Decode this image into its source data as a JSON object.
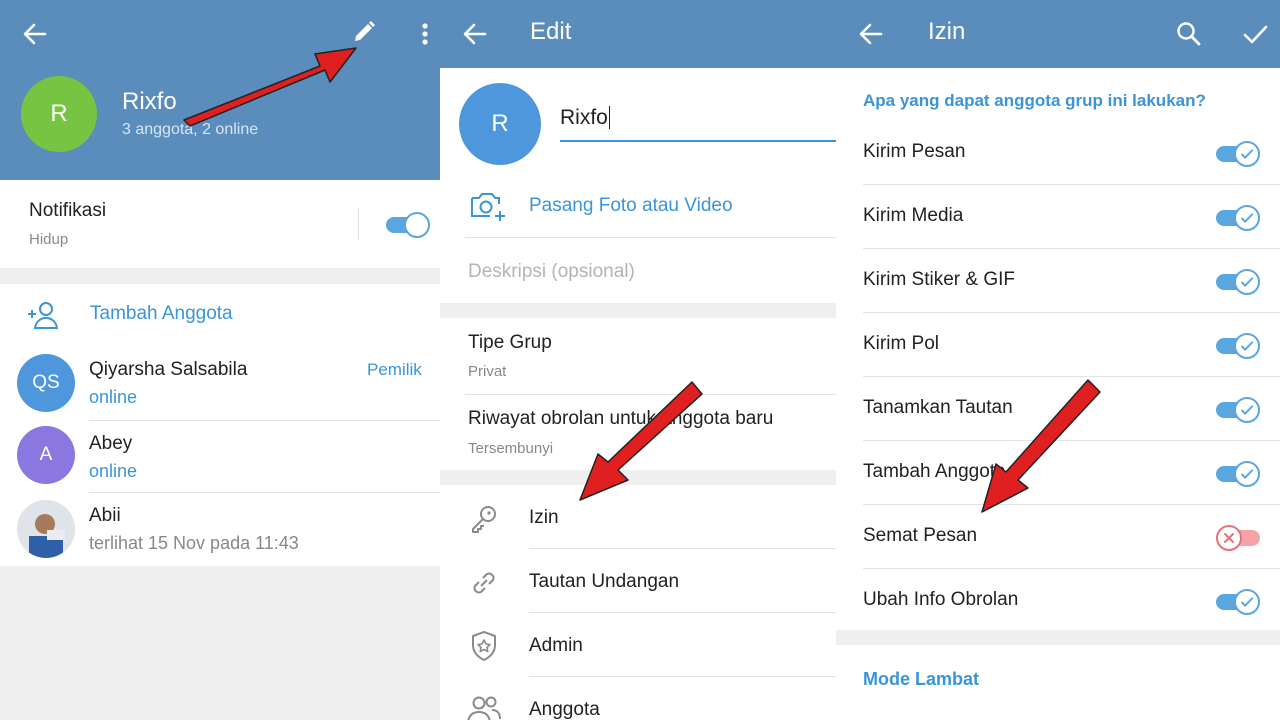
{
  "colors": {
    "header": "#5a8cbc",
    "accent": "#3a95d8",
    "arrow": "#e02020"
  },
  "panel1": {
    "group_name": "Rixfo",
    "group_status": "3 anggota, 2 online",
    "group_avatar_letter": "R",
    "notif_label": "Notifikasi",
    "notif_value": "Hidup",
    "add_member": "Tambah Anggota",
    "members": [
      {
        "initials": "QS",
        "name": "Qiyarsha Salsabila",
        "status": "online",
        "role": "Pemilik"
      },
      {
        "initials": "A",
        "name": "Abey",
        "status": "online",
        "role": ""
      },
      {
        "initials": "",
        "name": "Abii",
        "status": "terlihat  15 Nov pada 11:43",
        "role": ""
      }
    ]
  },
  "panel2": {
    "title": "Edit",
    "avatar_letter": "R",
    "name_value": "Rixfo",
    "set_photo": "Pasang Foto atau Video",
    "description_placeholder": "Deskripsi (opsional)",
    "group_type_label": "Tipe Grup",
    "group_type_value": "Privat",
    "history_label": "Riwayat obrolan untuk anggota baru",
    "history_value": "Tersembunyi",
    "menu": [
      {
        "icon": "key-icon",
        "label": "Izin"
      },
      {
        "icon": "link-icon",
        "label": "Tautan Undangan"
      },
      {
        "icon": "shield-star-icon",
        "label": "Admin"
      },
      {
        "icon": "people-icon",
        "label": "Anggota"
      }
    ]
  },
  "panel3": {
    "title": "Izin",
    "section_title": "Apa yang dapat anggota grup ini lakukan?",
    "permissions": [
      {
        "label": "Kirim Pesan",
        "enabled": true
      },
      {
        "label": "Kirim Media",
        "enabled": true
      },
      {
        "label": "Kirim Stiker & GIF",
        "enabled": true
      },
      {
        "label": "Kirim Pol",
        "enabled": true
      },
      {
        "label": "Tanamkan Tautan",
        "enabled": true
      },
      {
        "label": "Tambah Anggota",
        "enabled": true
      },
      {
        "label": "Semat Pesan",
        "enabled": false
      },
      {
        "label": "Ubah Info Obrolan",
        "enabled": true
      }
    ],
    "slow_mode": "Mode Lambat"
  }
}
